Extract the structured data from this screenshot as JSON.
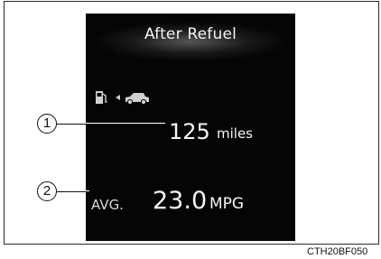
{
  "display": {
    "title": "After Refuel",
    "range": {
      "value": "125",
      "unit": "miles"
    },
    "average": {
      "label": "AVG.",
      "value": "23.0",
      "unit": "MPG"
    },
    "icons": {
      "fuel": "fuel-pump-icon",
      "arrow": "arrow-left-icon",
      "vehicle": "vehicle-icon"
    }
  },
  "callouts": [
    {
      "number": "1"
    },
    {
      "number": "2"
    }
  ],
  "figure_code": "CTH20BF050"
}
